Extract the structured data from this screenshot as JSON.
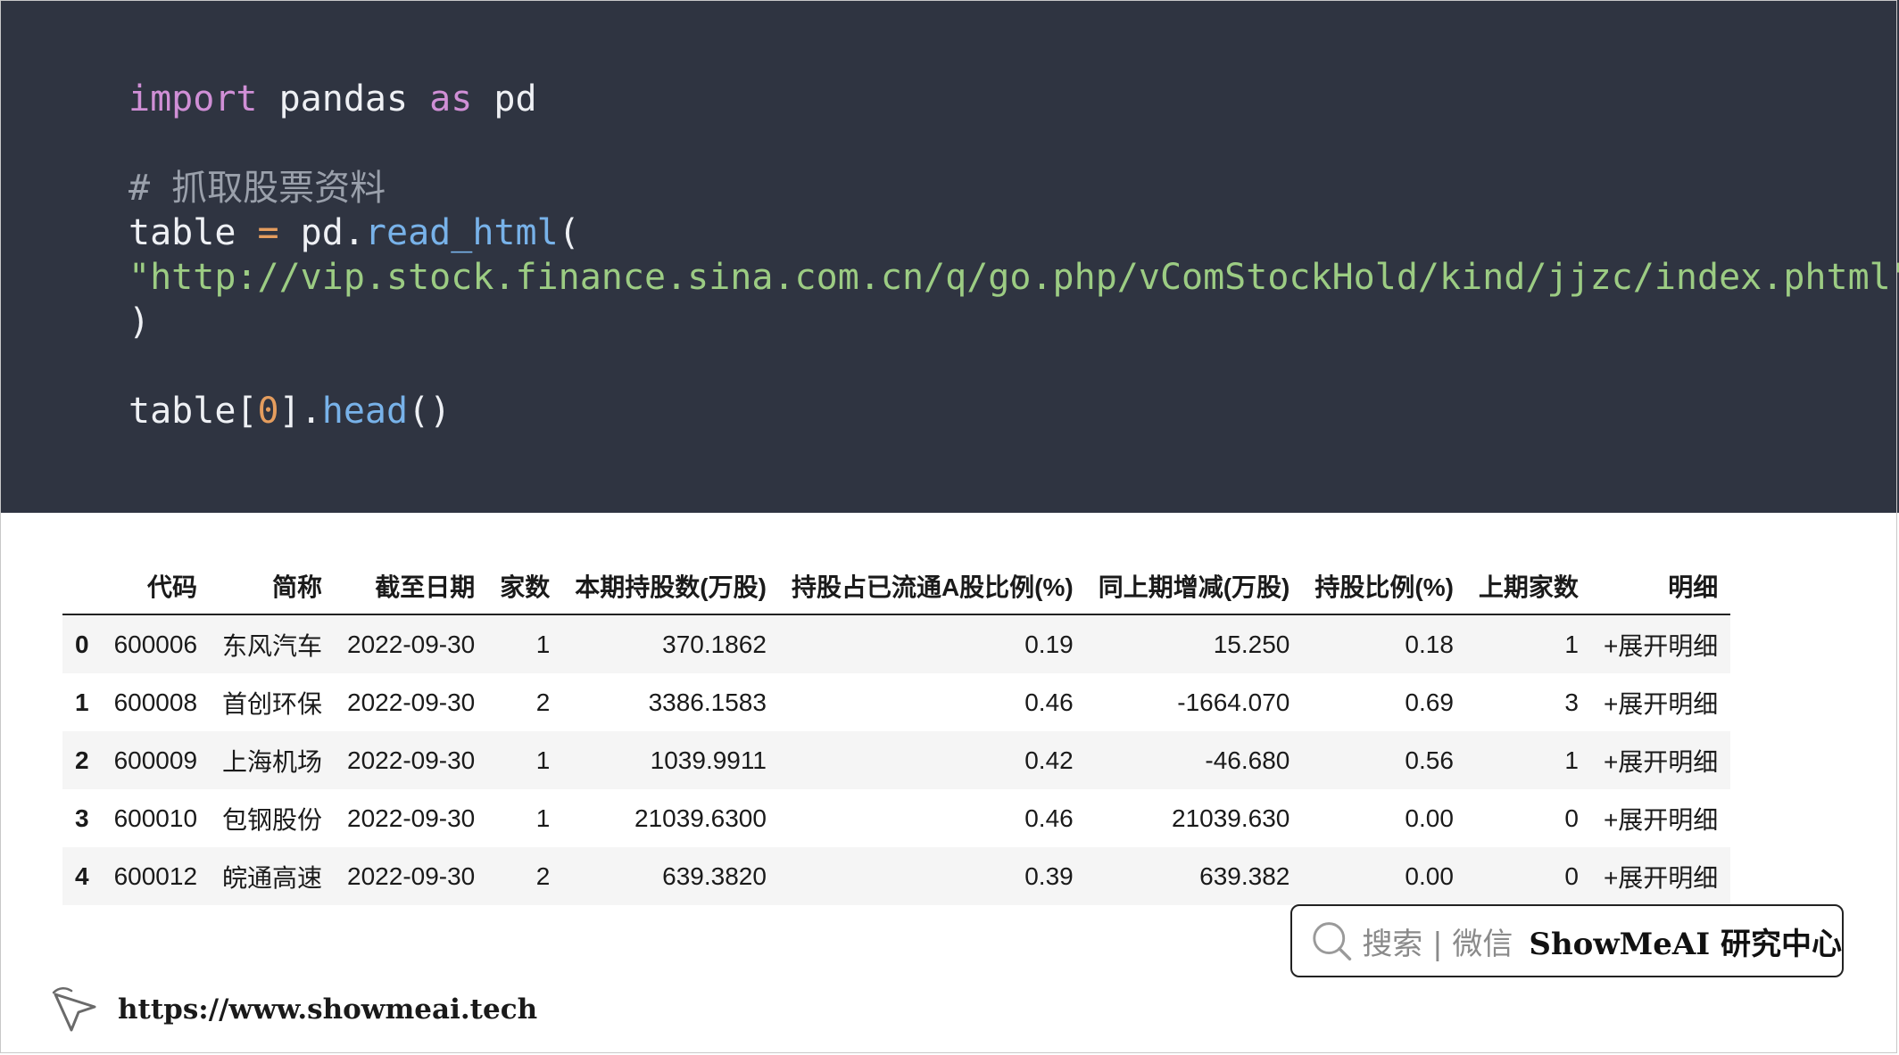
{
  "code": {
    "line1": {
      "kw_import": "import",
      "mod": " pandas ",
      "kw_as": "as",
      "alias": " pd"
    },
    "comment": "# 抓取股票资料",
    "line3": {
      "var": "table ",
      "op": "=",
      "obj": " pd.",
      "fn": "read_html",
      "paren": "("
    },
    "url": "\"http://vip.stock.finance.sina.com.cn/q/go.php/vComStockHold/kind/jjzc/index.phtml\"",
    "close": ")",
    "line5": {
      "var": "table[",
      "num": "0",
      "rest": "].",
      "fn": "head",
      "call": "()"
    }
  },
  "dataframe": {
    "columns": [
      "代码",
      "简称",
      "截至日期",
      "家数",
      "本期持股数(万股)",
      "持股占已流通A股比例(%)",
      "同上期增减(万股)",
      "持股比例(%)",
      "上期家数",
      "明细"
    ],
    "rows": [
      {
        "index": "0",
        "cells": [
          "600006",
          "东风汽车",
          "2022-09-30",
          "1",
          "370.1862",
          "0.19",
          "15.250",
          "0.18",
          "1",
          "+展开明细"
        ]
      },
      {
        "index": "1",
        "cells": [
          "600008",
          "首创环保",
          "2022-09-30",
          "2",
          "3386.1583",
          "0.46",
          "-1664.070",
          "0.69",
          "3",
          "+展开明细"
        ]
      },
      {
        "index": "2",
        "cells": [
          "600009",
          "上海机场",
          "2022-09-30",
          "1",
          "1039.9911",
          "0.42",
          "-46.680",
          "0.56",
          "1",
          "+展开明细"
        ]
      },
      {
        "index": "3",
        "cells": [
          "600010",
          "包钢股份",
          "2022-09-30",
          "1",
          "21039.6300",
          "0.46",
          "21039.630",
          "0.00",
          "0",
          "+展开明细"
        ]
      },
      {
        "index": "4",
        "cells": [
          "600012",
          "皖通高速",
          "2022-09-30",
          "2",
          "639.3820",
          "0.39",
          "639.382",
          "0.00",
          "0",
          "+展开明细"
        ]
      }
    ]
  },
  "badge": {
    "hint": "搜索 | 微信",
    "brand": "ShowMeAI 研究中心",
    "icon": "search-icon"
  },
  "footer": {
    "url": "https://www.showmeai.tech",
    "icon": "cursor-arrow-icon"
  },
  "colors": {
    "code_bg": "#2f3441",
    "keyword": "#d08fd6",
    "string": "#9ccc83",
    "function": "#78b2e9",
    "number": "#e59d5e",
    "comment": "#9aa0ab",
    "stripe": "#f5f5f5"
  }
}
